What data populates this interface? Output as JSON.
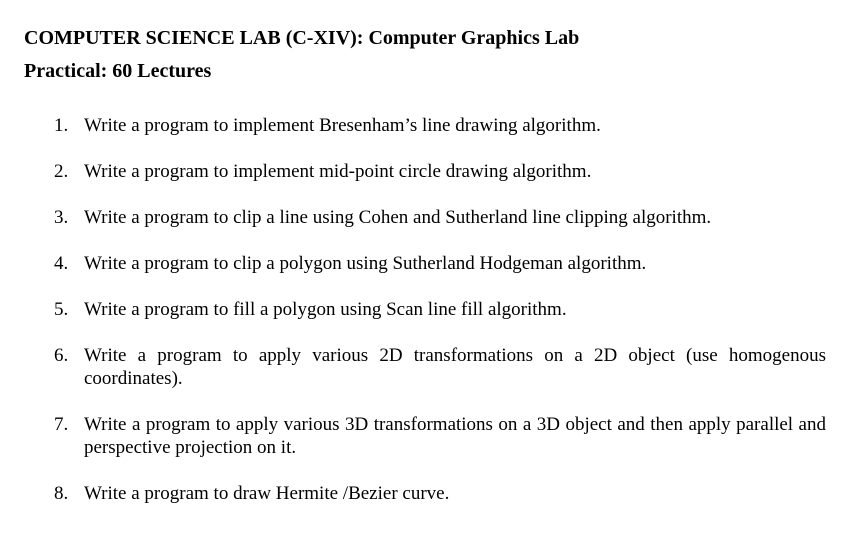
{
  "document": {
    "title": "COMPUTER SCIENCE LAB (C-XIV): Computer Graphics Lab",
    "subtitle": "Practical: 60 Lectures",
    "items": [
      {
        "number": "1.",
        "text": "Write a program to implement Bresenham’s line drawing algorithm."
      },
      {
        "number": "2.",
        "text": "Write a program to implement mid-point circle drawing algorithm."
      },
      {
        "number": "3.",
        "text": "Write a program to clip a line using Cohen and Sutherland line clipping algorithm."
      },
      {
        "number": "4.",
        "text": "Write a program to clip a polygon using Sutherland Hodgeman algorithm."
      },
      {
        "number": "5.",
        "text": "Write a program to fill a polygon using Scan line fill algorithm."
      },
      {
        "number": "6.",
        "text": "Write a program to apply various 2D transformations on a 2D object (use homogenous coordinates)."
      },
      {
        "number": "7.",
        "text": "Write a program to apply various 3D transformations on a 3D object and then apply parallel and perspective projection on it."
      },
      {
        "number": "8.",
        "text": "Write a program to draw Hermite /Bezier curve."
      }
    ]
  }
}
